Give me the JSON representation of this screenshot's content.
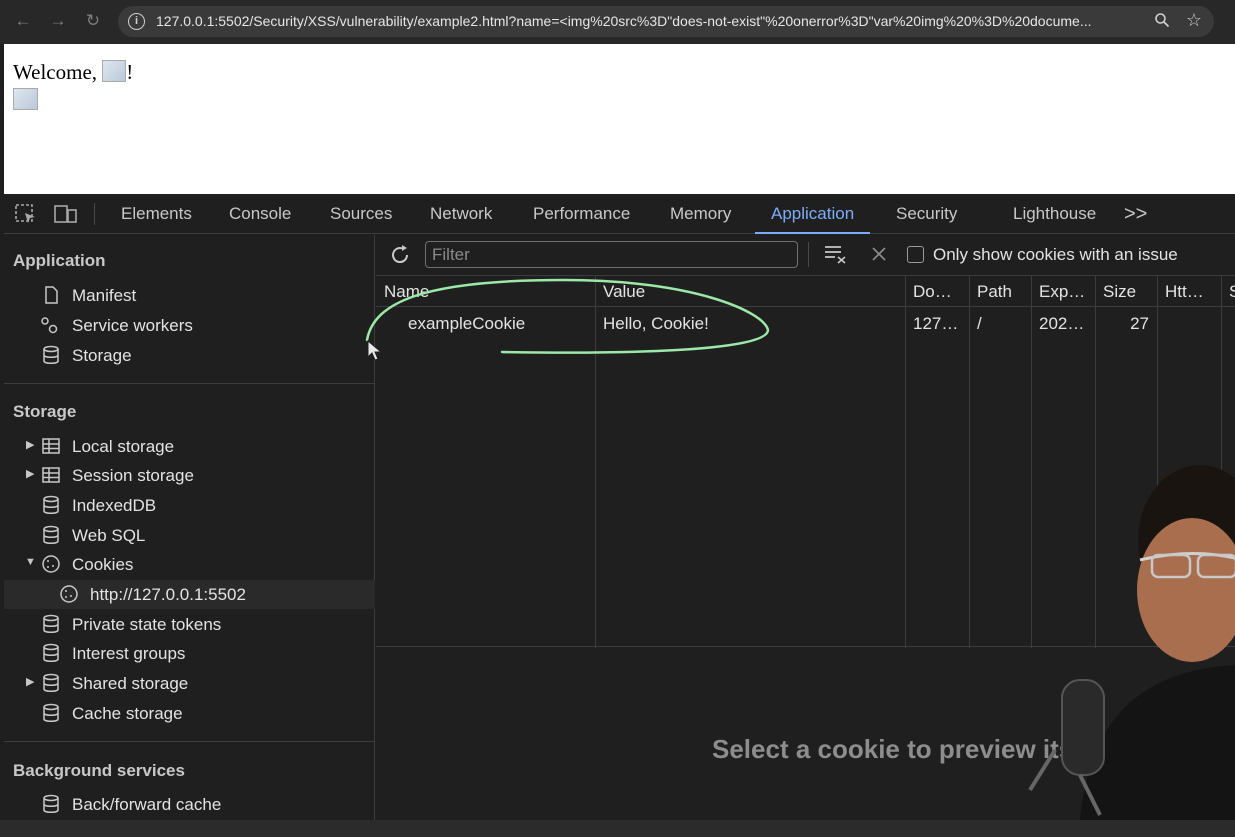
{
  "browser": {
    "url": "127.0.0.1:5502/Security/XSS/vulnerability/example2.html?name=<img%20src%3D\"does-not-exist\"%20onerror%3D\"var%20img%20%3D%20docume..."
  },
  "page": {
    "welcome_prefix": "Welcome, ",
    "welcome_suffix": "!"
  },
  "devtools": {
    "tabs": [
      {
        "label": "Elements"
      },
      {
        "label": "Console"
      },
      {
        "label": "Sources"
      },
      {
        "label": "Network"
      },
      {
        "label": "Performance"
      },
      {
        "label": "Memory"
      },
      {
        "label": "Application",
        "active": true
      },
      {
        "label": "Security"
      },
      {
        "label": "Lighthouse"
      }
    ],
    "more": ">>"
  },
  "sidebar": {
    "application_title": "Application",
    "application_items": [
      {
        "label": "Manifest",
        "icon": "document-icon"
      },
      {
        "label": "Service workers",
        "icon": "gears-icon"
      },
      {
        "label": "Storage",
        "icon": "database-icon"
      }
    ],
    "storage_title": "Storage",
    "storage_items": [
      {
        "label": "Local storage",
        "icon": "table-icon",
        "expandable": true
      },
      {
        "label": "Session storage",
        "icon": "table-icon",
        "expandable": true
      },
      {
        "label": "IndexedDB",
        "icon": "database-icon"
      },
      {
        "label": "Web SQL",
        "icon": "database-icon"
      },
      {
        "label": "Cookies",
        "icon": "cookie-icon",
        "expanded": true
      },
      {
        "label": "http://127.0.0.1:5502",
        "icon": "cookie-icon",
        "child": true,
        "selected": true
      },
      {
        "label": "Private state tokens",
        "icon": "database-icon"
      },
      {
        "label": "Interest groups",
        "icon": "database-icon"
      },
      {
        "label": "Shared storage",
        "icon": "database-icon",
        "expandable": true
      },
      {
        "label": "Cache storage",
        "icon": "database-icon"
      }
    ],
    "background_title": "Background services",
    "background_items": [
      {
        "label": "Back/forward cache",
        "icon": "database-icon"
      }
    ]
  },
  "cookies": {
    "filter_placeholder": "Filter",
    "issue_checkbox_label": "Only show cookies with an issue",
    "columns": [
      "Name",
      "Value",
      "Do…",
      "Path",
      "Exp…",
      "Size",
      "Htt…",
      "S"
    ],
    "rows": [
      {
        "name": "exampleCookie",
        "value": "Hello, Cookie!",
        "domain": "127…",
        "path": "/",
        "expires": "202…",
        "size": "27"
      }
    ],
    "preview_message": "Select a cookie to preview its value"
  },
  "colors": {
    "accent": "#7cacf8",
    "annotation": "#9be8a8"
  }
}
